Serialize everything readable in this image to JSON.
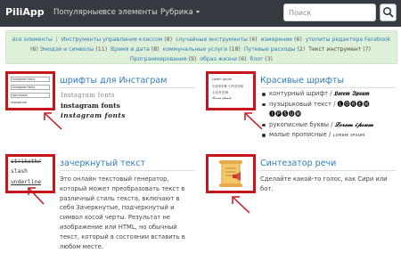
{
  "navbar": {
    "brand": "PiliApp",
    "links": [
      "Популярные",
      "все элементы",
      "Рубрика"
    ],
    "search_placeholder": "Поиск"
  },
  "categories": [
    {
      "label": "все элементы",
      "count": ""
    },
    {
      "label": "Инструменты управления классом",
      "count": "(8)"
    },
    {
      "label": "случайные инструменты",
      "count": "(6)"
    },
    {
      "label": "измерение",
      "count": "(6)"
    },
    {
      "label": "утилиты редактора Facebook",
      "count": "(6)"
    },
    {
      "label": "Эмодзи и символы",
      "count": "(11)"
    },
    {
      "label": "Время и дата",
      "count": "(8)"
    },
    {
      "label": "коммунальные услуги",
      "count": "(18)"
    },
    {
      "label": "Путевые расходы",
      "count": "(2)"
    },
    {
      "label": "Текст инструмент",
      "count": "(7)"
    },
    {
      "label": "Программирование",
      "count": "(9)"
    },
    {
      "label": "образ жизни",
      "count": "(6)"
    },
    {
      "label": "блог",
      "count": "(3)"
    }
  ],
  "cards": {
    "insta": {
      "title": "шрифты для Инстаграм",
      "thumb_lines": [
        "Instagram fonts",
        "instagram fonts",
        "ɪɴsᴛᴀɢʀᴀᴍ"
      ],
      "preview": [
        "Instagram fonts",
        "instagram fonts",
        "instagram fonts"
      ]
    },
    "pretty": {
      "title": "Красивые шрифты",
      "thumb_lines": [
        "Lorem Ipsum",
        "ⓁⓄⓇⒺⓂ ⒾⓅⓈⓊⓂ",
        "𝓛𝓸𝓻𝓮𝓶 𝓲𝓹𝓼𝓾𝓶"
      ],
      "items": [
        {
          "label": "контурный шрифт / ",
          "sample": "𝕷𝖔𝖗𝖊𝖒 𝕴𝖕𝖘𝖚𝖒"
        },
        {
          "label": "пузырьковый текст / ",
          "sample": "🅛🅞🅡🅔🅜 🅘🅟🅢🅤🅜"
        },
        {
          "label": "рукописные буквы / ",
          "sample": "𝓛𝓸𝓻𝓮𝓶 𝓲𝓹𝓼𝓾𝓶"
        },
        {
          "label": "малые прописные / ",
          "sample": "ʟᴏʀᴇᴍ ɪᴘsᴜᴍ"
        }
      ]
    },
    "strike": {
      "title": "зачеркнутый текст",
      "thumb_lines": [
        "strikethr",
        "slash",
        "underline"
      ],
      "description": "Это онлайн текстовый генератор, который может преобразовать текст в различный стиль текста, включают в себя Зачеркнутые, подчеркнутый и символ косой черты. Результат не изображение или HTML, но обычный текст, который в состоянии вставить в любом месте."
    },
    "speech": {
      "title": "Синтезатор речи",
      "description": "Сделайте какой-то голос, как Сири или бот."
    }
  },
  "colors": {
    "navbar": "#343a40",
    "category_bg": "#dff0d8",
    "link": "#2e7bb8",
    "highlight_border": "#c4161c"
  }
}
